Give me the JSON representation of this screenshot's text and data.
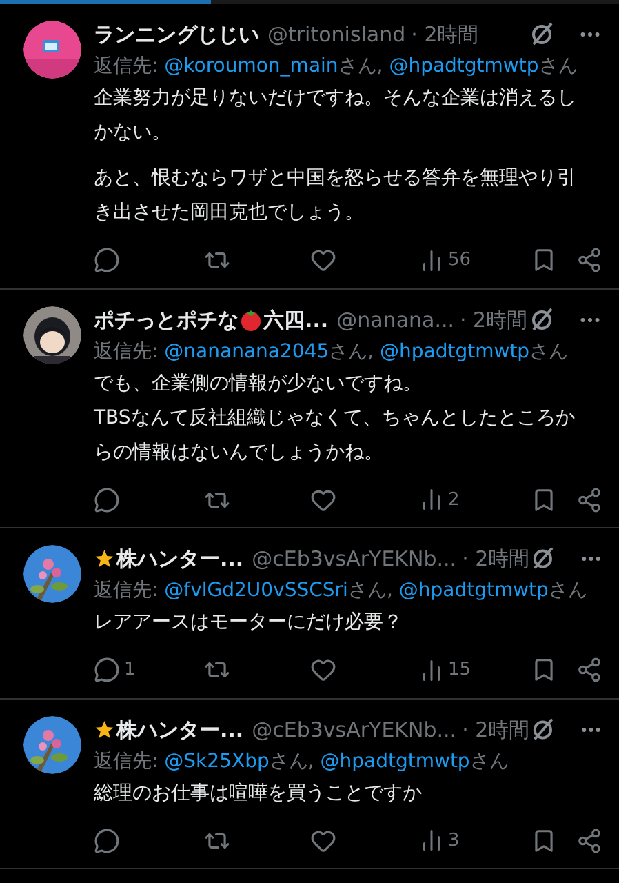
{
  "loading_bar": {
    "level": 0.34
  },
  "posts": [
    {
      "avatar": {
        "kind": "picture"
      },
      "name": [
        {
          "kind": "text",
          "text": "ランニングじじい"
        }
      ],
      "handle": "@tritonisland",
      "time": "· 2時間",
      "reply_to": [
        {
          "handle": "@koroumon_main",
          "suffix": "さん, "
        },
        {
          "handle": "@hpadtgtmwtp",
          "suffix": "さん"
        }
      ],
      "reply_label": "返信先: ",
      "body": [
        "企業努力が足りないだけですね。そんな企業は消えるしかない。",
        "あと、恨むならワザと中国を怒らせる答弁を無理やり引き出させた岡田克也でしょう。"
      ],
      "views": "56"
    },
    {
      "avatar": {
        "kind": "picture"
      },
      "name": [
        {
          "kind": "text",
          "text": "ポチっとポチな"
        },
        {
          "kind": "tomato"
        },
        {
          "kind": "text",
          "text": "六四..."
        }
      ],
      "handle": "@nanana...",
      "time": "· 2時間",
      "reply_to": [
        {
          "handle": "@nananana2045",
          "suffix": "さん, "
        },
        {
          "handle": "@hpadtgtmwtp",
          "suffix": "さん"
        }
      ],
      "reply_label": "返信先: ",
      "body": [
        "でも、企業側の情報が少ないですね。\nTBSなんて反社組織じゃなくて、ちゃんとしたところからの情報はないんでしょうかね。"
      ],
      "views": "2"
    },
    {
      "avatar": {
        "kind": "picture"
      },
      "name": [
        {
          "kind": "star"
        },
        {
          "kind": "text",
          "text": "株ハンター..."
        }
      ],
      "handle": "@cEb3vsArYEKNb...",
      "time": "· 2時間",
      "reply_to": [
        {
          "handle": "@fvlGd2U0vSSCSri",
          "suffix": "さん, "
        },
        {
          "handle": "@hpadtgtmwtp",
          "suffix": "さん"
        }
      ],
      "reply_label": "返信先: ",
      "body": [
        "レアアースはモーターにだけ必要？"
      ],
      "replies": "1",
      "views": "15"
    },
    {
      "avatar": {
        "kind": "picture"
      },
      "name": [
        {
          "kind": "star"
        },
        {
          "kind": "text",
          "text": "株ハンター..."
        }
      ],
      "handle": "@cEb3vsArYEKNb...",
      "time": "· 2時間",
      "reply_to": [
        {
          "handle": "@Sk25Xbp",
          "suffix": "さん, "
        },
        {
          "handle": "@hpadtgtmwtp",
          "suffix": "さん"
        }
      ],
      "reply_label": "返信先: ",
      "body": [
        "総理のお仕事は喧嘩を買うことですか"
      ],
      "views": "3"
    }
  ]
}
